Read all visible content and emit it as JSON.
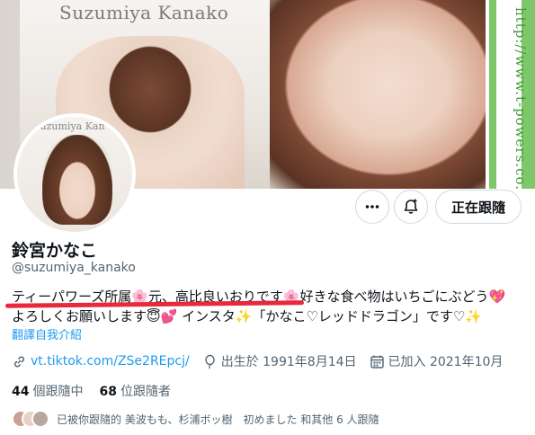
{
  "banner": {
    "name_text": "Suzumiya Kanako",
    "url_text": "http://www.t-powers.co.jp"
  },
  "avatar": {
    "name_text": "Suzumiya Kan"
  },
  "actions": {
    "more_icon": "more-horizontal-icon",
    "notify_icon": "bell-plus-icon",
    "follow_label": "正在跟隨"
  },
  "profile": {
    "display_name": "鈴宮かなこ",
    "handle": "@suzumiya_kanako",
    "bio_line1": "ティーパワーズ所属🌸元、高比良いおりです🌸好きな食べ物はいちごにぶどう💖",
    "bio_line2": "よろしくお願いします😇💕 インスタ✨「かなこ♡レッドドラゴン」です♡✨",
    "translate_label": "翻譯自我介紹"
  },
  "meta": {
    "link": "vt.tiktok.com/ZSe2REpcj/",
    "birthday": "出生於 1991年8月14日",
    "joined": "已加入 2021年10月"
  },
  "stats": {
    "following_count": "44",
    "following_label": "個跟隨中",
    "followers_count": "68",
    "followers_label": "位跟隨者"
  },
  "known_followers": "已被你跟隨的 美波もも、杉浦ボッ樹　初めました 和其他 6 人跟隨",
  "colors": {
    "accent": "#1d9bf0",
    "text_primary": "#0f1419",
    "text_secondary": "#536471",
    "annotation_red": "#e8283c"
  }
}
